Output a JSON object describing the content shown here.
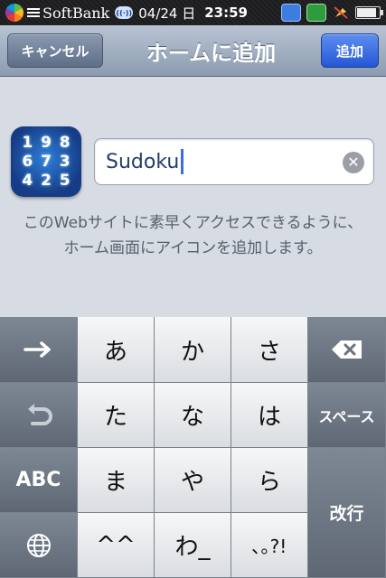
{
  "status_bar": {
    "carrier": "SoftBank",
    "date": "04/24 日",
    "time": "23:59"
  },
  "nav": {
    "cancel_label": "キャンセル",
    "title": "ホームに追加",
    "add_label": "追加"
  },
  "app_icon": {
    "digits": [
      "1",
      "9",
      "8",
      "6",
      "7",
      "3",
      "4",
      "2",
      "5"
    ]
  },
  "title_field": {
    "value": "Sudoku"
  },
  "description": "このWebサイトに素早くアクセスできるように、ホーム画面にアイコンを追加します。",
  "keyboard": {
    "row1": [
      "あ",
      "か",
      "さ"
    ],
    "row2": [
      "た",
      "な",
      "は"
    ],
    "row3": [
      "ま",
      "や",
      "ら"
    ],
    "row4": [
      "^^",
      "わ_",
      "､｡?!"
    ],
    "abc_label": "ABC",
    "space_label": "スペース",
    "return_label": "改行",
    "icons": [
      "right-arrow-icon",
      "undo-icon",
      "globe-icon",
      "backspace-icon"
    ]
  }
}
